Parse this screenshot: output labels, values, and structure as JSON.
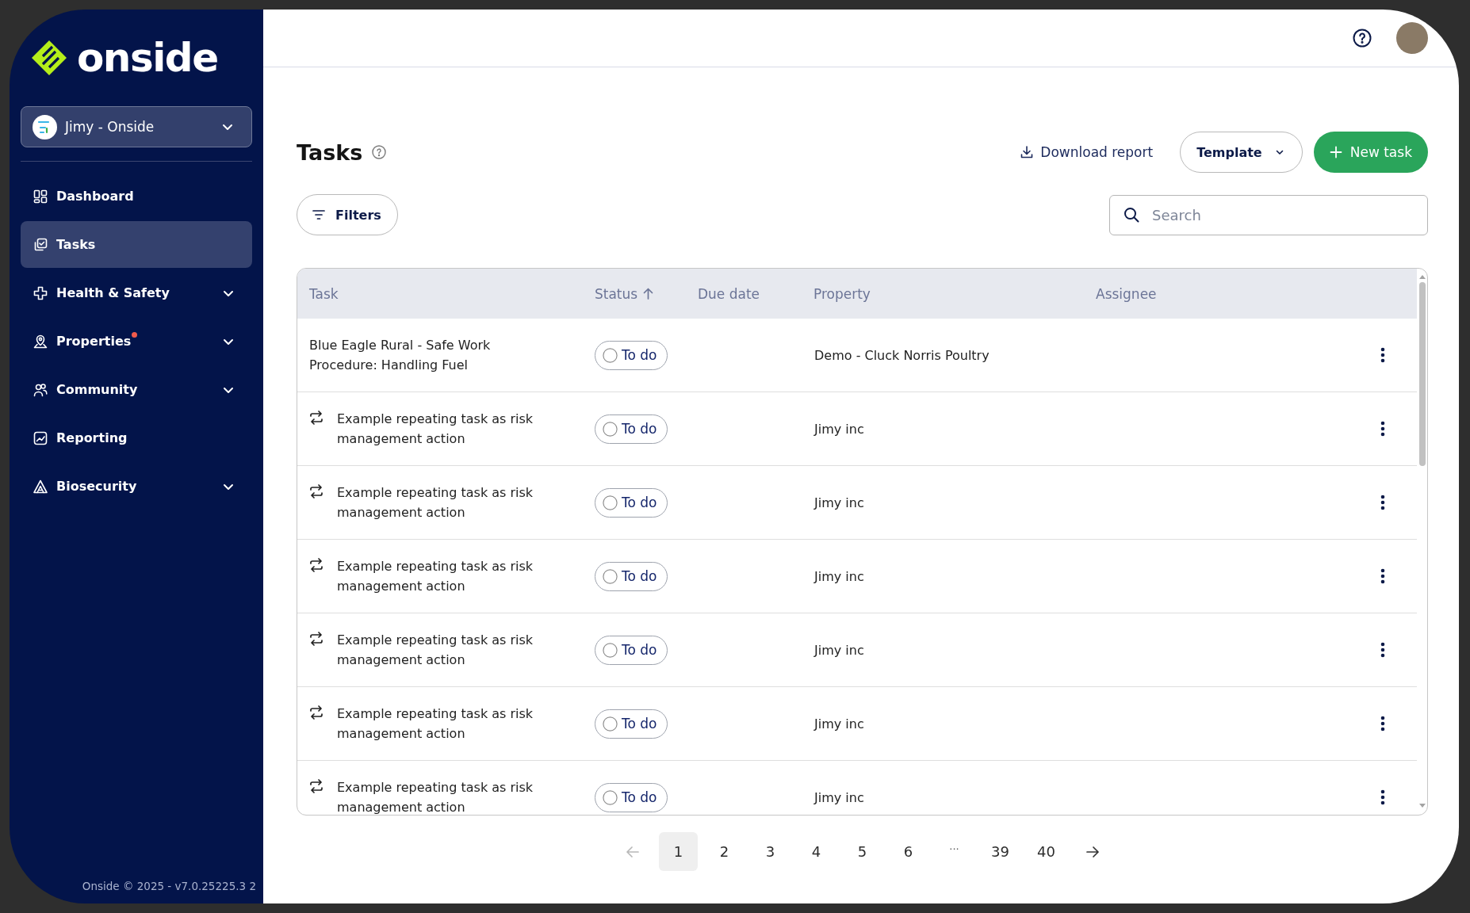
{
  "sidebar": {
    "logo": "onside",
    "workspace": {
      "name": "Jimy - Onside"
    },
    "nav": [
      {
        "label": "Dashboard",
        "selected": false,
        "expandable": false,
        "notification": false
      },
      {
        "label": "Tasks",
        "selected": true,
        "expandable": false,
        "notification": false
      },
      {
        "label": "Health & Safety",
        "selected": false,
        "expandable": true,
        "notification": false
      },
      {
        "label": "Properties",
        "selected": false,
        "expandable": true,
        "notification": true
      },
      {
        "label": "Community",
        "selected": false,
        "expandable": true,
        "notification": false
      },
      {
        "label": "Reporting",
        "selected": false,
        "expandable": false,
        "notification": false
      },
      {
        "label": "Biosecurity",
        "selected": false,
        "expandable": true,
        "notification": false
      }
    ],
    "footer": "Onside © 2025 - v7.0.25225.3 2"
  },
  "page": {
    "title": "Tasks",
    "download_report": "Download report",
    "template_button": "Template",
    "new_task_button": "New task",
    "filters_button": "Filters",
    "search": {
      "placeholder": "Search"
    }
  },
  "table": {
    "columns": [
      {
        "label": "Task",
        "sorted": false
      },
      {
        "label": "Status",
        "sorted": true
      },
      {
        "label": "Due date",
        "sorted": false
      },
      {
        "label": "Property",
        "sorted": false
      },
      {
        "label": "Assignee",
        "sorted": false
      }
    ],
    "rows": [
      {
        "task": "Blue Eagle Rural - Safe Work Procedure: Handling Fuel",
        "repeating": false,
        "status": "To do",
        "completed": false,
        "property": "Demo - Cluck Norris Poultry"
      },
      {
        "task": "Example repeating task as risk management action",
        "repeating": true,
        "status": "To do",
        "completed": false,
        "property": "Jimy inc"
      },
      {
        "task": "Example repeating task as risk management action",
        "repeating": true,
        "status": "To do",
        "completed": false,
        "property": "Jimy inc"
      },
      {
        "task": "Example repeating task as risk management action",
        "repeating": true,
        "status": "To do",
        "completed": false,
        "property": "Jimy inc"
      },
      {
        "task": "Example repeating task as risk management action",
        "repeating": true,
        "status": "To do",
        "completed": false,
        "property": "Jimy inc"
      },
      {
        "task": "Example repeating task as risk management action",
        "repeating": true,
        "status": "To do",
        "completed": false,
        "property": "Jimy inc"
      },
      {
        "task": "Example repeating task as risk management action",
        "repeating": true,
        "status": "To do",
        "completed": false,
        "property": "Jimy inc"
      }
    ]
  },
  "pagination": {
    "previous_disabled": true,
    "next_disabled": false,
    "pages": [
      {
        "kind": "page",
        "label": "1",
        "selected": true
      },
      {
        "kind": "page",
        "label": "2",
        "selected": false
      },
      {
        "kind": "page",
        "label": "3",
        "selected": false
      },
      {
        "kind": "page",
        "label": "4",
        "selected": false
      },
      {
        "kind": "page",
        "label": "5",
        "selected": false
      },
      {
        "kind": "page",
        "label": "6",
        "selected": false
      },
      {
        "kind": "ellipsis",
        "label": "...",
        "selected": false
      },
      {
        "kind": "page",
        "label": "39",
        "selected": false
      },
      {
        "kind": "page",
        "label": "40",
        "selected": false
      }
    ]
  }
}
